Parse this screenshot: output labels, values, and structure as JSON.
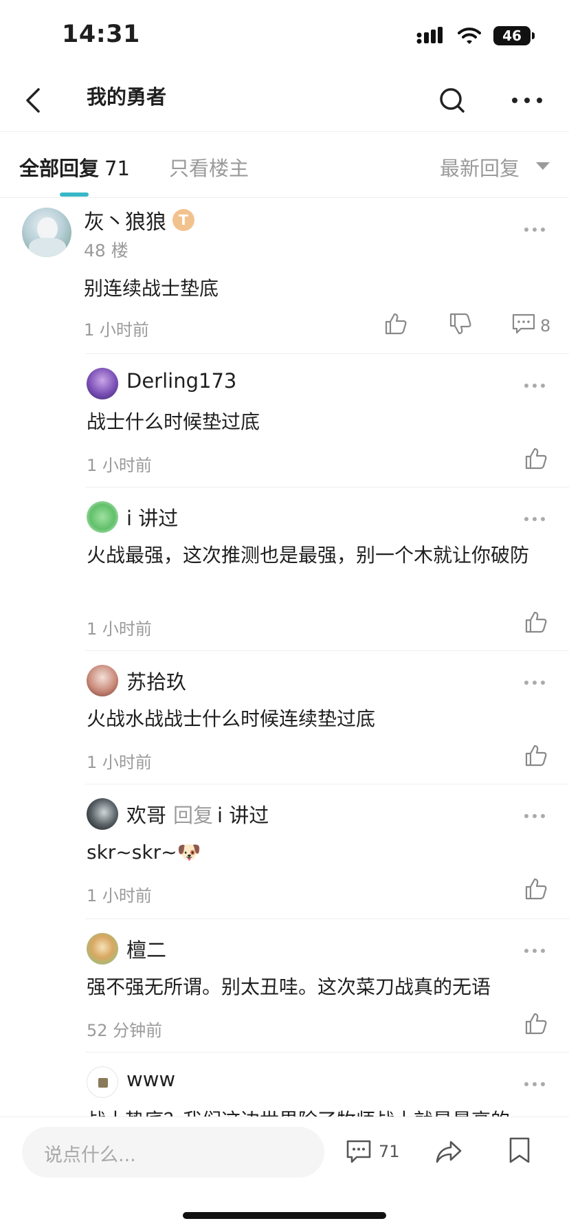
{
  "status_bar": {
    "time": "14:31",
    "battery": "46",
    "icons": [
      "signal-icon",
      "wifi-icon",
      "battery-icon"
    ]
  },
  "nav": {
    "title": "我的勇者",
    "icons": [
      "back-icon",
      "search-icon",
      "more-icon"
    ]
  },
  "tabs": {
    "all_label": "全部回复",
    "all_count": "71",
    "owner_only": "只看楼主",
    "sort": "最新回复",
    "accent_color": "#37b7c7"
  },
  "main_comment": {
    "user": "灰丶狼狼",
    "badge": "T",
    "floor": "48 楼",
    "text": "别连续战士垫底",
    "time": "1 小时前",
    "reply_count": "8"
  },
  "replies": [
    {
      "user": "Derling173",
      "reply_to_label": "",
      "reply_to": "",
      "text": "战士什么时候垫过底",
      "time": "1 小时前"
    },
    {
      "user": "i 讲过",
      "reply_to_label": "",
      "reply_to": "",
      "text": "火战最强，这次推测也是最强，别一个木就让你破防",
      "time": "1 小时前"
    },
    {
      "user": "苏拾玖",
      "reply_to_label": "",
      "reply_to": "",
      "text": "火战水战战士什么时候连续垫过底",
      "time": "1 小时前"
    },
    {
      "user": "欢哥",
      "reply_to_label": "回复",
      "reply_to": "i 讲过",
      "text": "skr~skr~🐶",
      "time": "1 小时前"
    },
    {
      "user": "檀二",
      "reply_to_label": "",
      "reply_to": "",
      "text": "强不强无所谓。别太丑哇。这次菜刀战真的无语",
      "time": "52 分钟前"
    },
    {
      "user": "www",
      "reply_to_label": "",
      "reply_to": "",
      "text": "战士垫底？我们这边世界除了牧师战士就是最高的",
      "time": ""
    }
  ],
  "bottom_bar": {
    "placeholder": "说点什么...",
    "comment_count": "71",
    "icons": [
      "comment-icon",
      "share-icon",
      "bookmark-icon"
    ]
  }
}
